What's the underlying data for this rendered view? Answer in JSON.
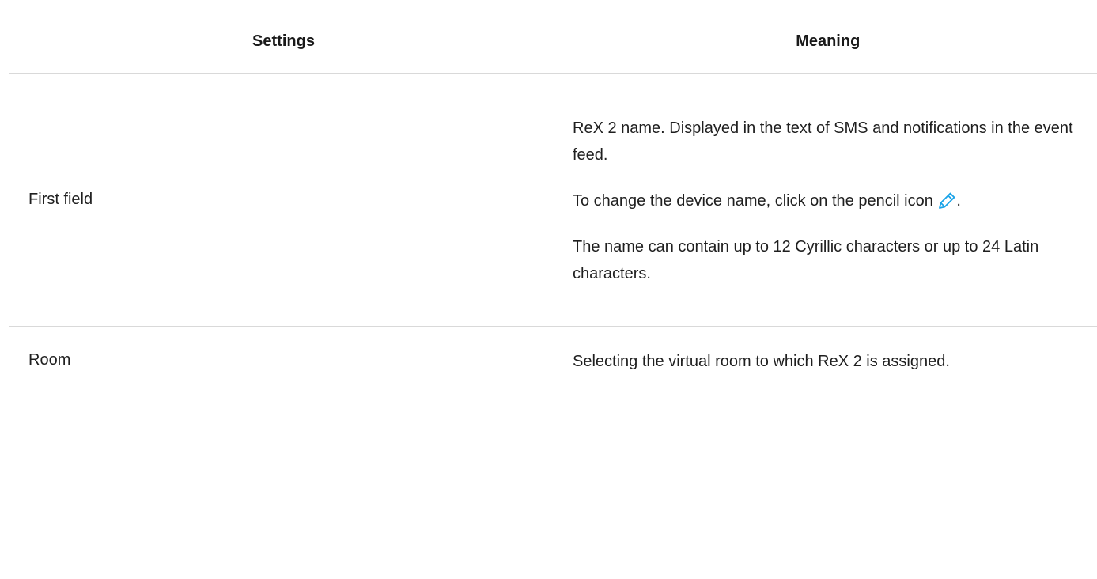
{
  "table": {
    "headers": {
      "settings": "Settings",
      "meaning": "Meaning"
    },
    "rows": [
      {
        "setting": "First field",
        "meaning": {
          "p1": "ReX 2 name. Displayed in the text of SMS and notifications in the event feed.",
          "p2_before_icon": "To change the device name, click on the pencil icon",
          "p2_after_icon": ".",
          "p3": "The name can contain up to 12 Cyrillic characters or up to 24 Latin characters."
        }
      },
      {
        "setting": "Room",
        "meaning": {
          "p1": "Selecting the virtual room to which ReX 2 is assigned."
        }
      }
    ]
  },
  "icons": {
    "pencil": {
      "name": "pencil-icon",
      "color": "#1aa3e8"
    }
  }
}
